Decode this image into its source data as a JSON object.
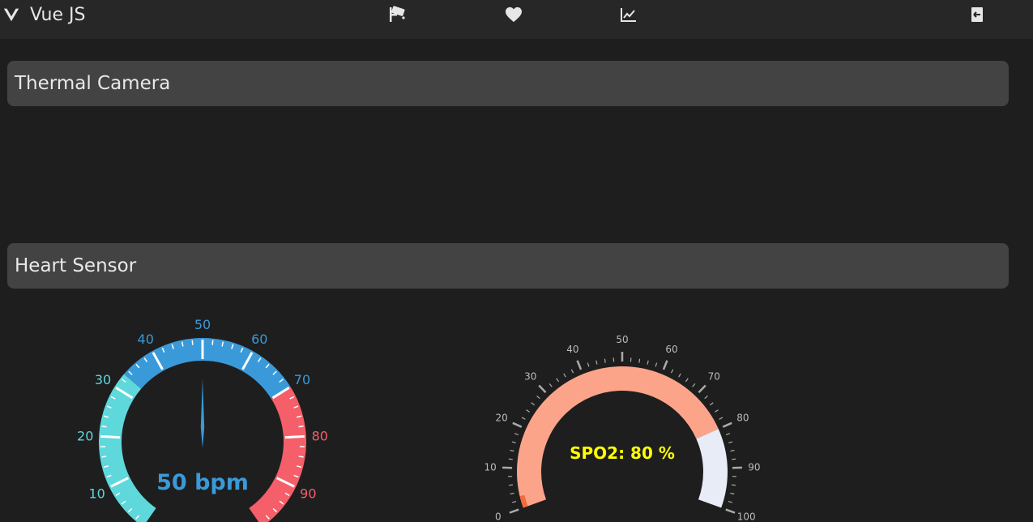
{
  "topbar": {
    "brand": "Vue JS",
    "icons": [
      "vue-logo-icon",
      "security-camera-icon",
      "heart-icon",
      "line-chart-icon",
      "logout-icon"
    ]
  },
  "sections": {
    "thermal_title": "Thermal Camera",
    "heart_title": "Heart Sensor"
  },
  "bpm_gauge": {
    "value": 50,
    "readout": "50 bpm",
    "min": 0,
    "max": 100,
    "labels": [
      "10",
      "20",
      "30",
      "40",
      "50",
      "60",
      "70",
      "80",
      "90"
    ],
    "colors": {
      "low": "#5fd8dc",
      "mid": "#3a9ad9",
      "high": "#f45f6a"
    }
  },
  "spo2_gauge": {
    "value": 80,
    "readout": "SPO2: 80 %",
    "min": 0,
    "max": 100,
    "labels": [
      "0",
      "10",
      "20",
      "30",
      "40",
      "50",
      "60",
      "70",
      "80",
      "90",
      "100"
    ],
    "colors": {
      "fill": "#fca48a",
      "remaining": "#e8ecf6",
      "start": "#f26b3a",
      "readout": "#ffff00"
    }
  }
}
